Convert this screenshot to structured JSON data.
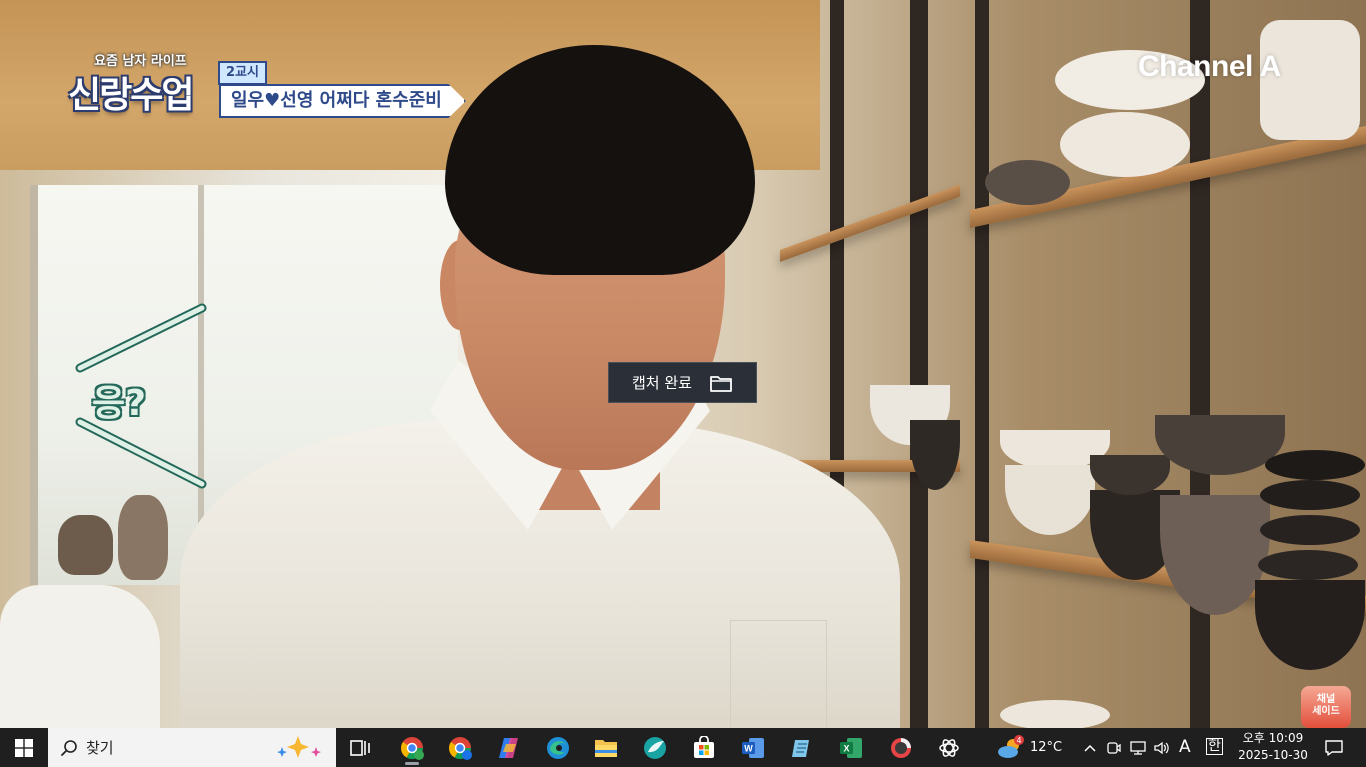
{
  "video": {
    "show_subtitle": "요즘 남자 라이프",
    "show_title": "신랑수업",
    "lesson_badge": "2교시",
    "lesson_title": "일우♥선영 어쩌다 혼수준비",
    "channel_logo": "Channel A",
    "emote_text": "응?",
    "corner_logo_line1": "채널",
    "corner_logo_line2": "세이드"
  },
  "toast": {
    "label": "캡처 완료",
    "icon": "folder-icon"
  },
  "taskbar": {
    "start_icon": "windows-start-icon",
    "search_label": "찾기",
    "search_icon": "search-icon",
    "pinned": [
      {
        "name": "task-view-icon"
      },
      {
        "name": "chrome-profile-icon",
        "active": true
      },
      {
        "name": "chrome-icon"
      },
      {
        "name": "copilot-icon"
      },
      {
        "name": "edge-icon"
      },
      {
        "name": "file-explorer-icon"
      },
      {
        "name": "app-icon"
      },
      {
        "name": "microsoft-store-icon"
      },
      {
        "name": "word-icon"
      },
      {
        "name": "notepad-icon"
      },
      {
        "name": "excel-icon"
      },
      {
        "name": "media-icon"
      },
      {
        "name": "chatgpt-icon"
      }
    ],
    "weather": {
      "temp": "12°C",
      "badge": "4"
    },
    "ime_mode": "A",
    "ime_lang": "한",
    "clock": {
      "time": "오후 10:09",
      "date": "2025-10-30"
    },
    "colors": {
      "taskbar_bg": "#1f1f1f",
      "search_bg": "#f3f3f3"
    }
  }
}
